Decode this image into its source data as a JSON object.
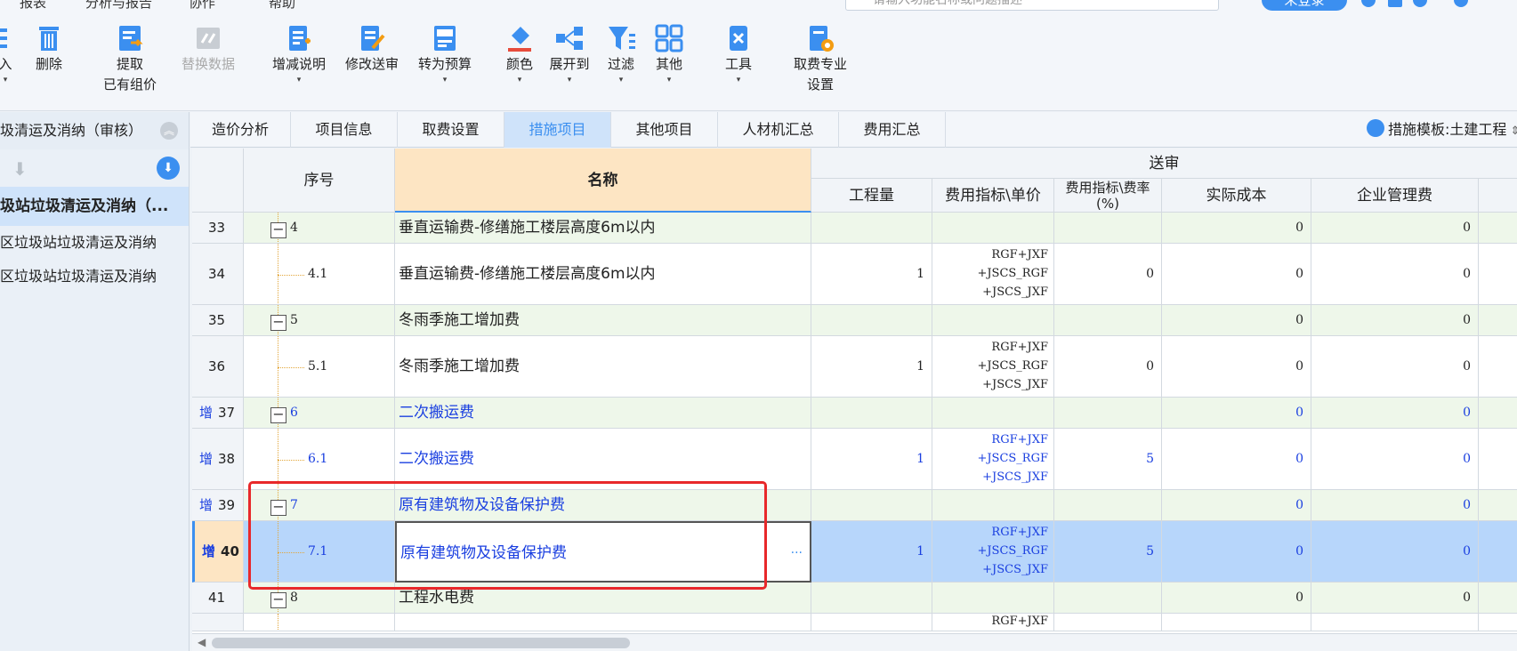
{
  "menu": [
    "报表",
    "分析与报告",
    "协作",
    "帮助"
  ],
  "search": {
    "placeholder": "请输入功能名称或问题描述"
  },
  "login_label": "未登录",
  "toolbar": {
    "import_partial": "入",
    "delete": "删除",
    "extract": "提取",
    "extract_sub": "已有组价",
    "replace": "替换数据",
    "adjust": "增减说明",
    "modify": "修改送审",
    "to_budget": "转为预算",
    "color": "颜色",
    "expand": "展开到",
    "filter": "过滤",
    "other": "其他",
    "tools": "工具",
    "fee_setting": "取费专业",
    "fee_setting_sub": "设置"
  },
  "left": {
    "header": "圾清运及消纳（审核）",
    "selected": "圾站垃圾清运及消纳（...",
    "items": [
      "区垃圾站垃圾清运及消纳",
      "区垃圾站垃圾清运及消纳"
    ]
  },
  "tabs": [
    "造价分析",
    "项目信息",
    "取费设置",
    "措施项目",
    "其他项目",
    "人材机汇总",
    "费用汇总"
  ],
  "active_tab": "措施项目",
  "measure_template": "措施模板:土建工程",
  "grid": {
    "headers": {
      "seq": "序号",
      "name": "名称",
      "group": "送审",
      "qty": "工程量",
      "unit_price": "费用指标\\单价",
      "rate": "费用指标\\费率(%)",
      "cost": "实际成本",
      "mgmt": "企业管理费"
    },
    "rows": [
      {
        "row": "33",
        "prefix": "",
        "seq": "4",
        "level": 1,
        "name": "垂直运输费-修缮施工楼层高度6m以内",
        "qty": "",
        "formula": [],
        "rate": "",
        "cost": "0",
        "mgmt": "0",
        "added": false
      },
      {
        "row": "34",
        "prefix": "",
        "seq": "4.1",
        "level": 2,
        "name": "垂直运输费-修缮施工楼层高度6m以内",
        "qty": "1",
        "formula": [
          "RGF+JXF",
          "+JSCS_RGF",
          "+JSCS_JXF"
        ],
        "rate": "0",
        "cost": "0",
        "mgmt": "0",
        "added": false
      },
      {
        "row": "35",
        "prefix": "",
        "seq": "5",
        "level": 1,
        "name": "冬雨季施工增加费",
        "qty": "",
        "formula": [],
        "rate": "",
        "cost": "0",
        "mgmt": "0",
        "added": false
      },
      {
        "row": "36",
        "prefix": "",
        "seq": "5.1",
        "level": 2,
        "name": "冬雨季施工增加费",
        "qty": "1",
        "formula": [
          "RGF+JXF",
          "+JSCS_RGF",
          "+JSCS_JXF"
        ],
        "rate": "0",
        "cost": "0",
        "mgmt": "0",
        "added": false
      },
      {
        "row": "37",
        "prefix": "增",
        "seq": "6",
        "level": 1,
        "name": "二次搬运费",
        "qty": "",
        "formula": [],
        "rate": "",
        "cost": "0",
        "mgmt": "0",
        "added": true
      },
      {
        "row": "38",
        "prefix": "增",
        "seq": "6.1",
        "level": 2,
        "name": "二次搬运费",
        "qty": "1",
        "formula": [
          "RGF+JXF",
          "+JSCS_RGF",
          "+JSCS_JXF"
        ],
        "rate": "5",
        "cost": "0",
        "mgmt": "0",
        "added": true
      },
      {
        "row": "39",
        "prefix": "增",
        "seq": "7",
        "level": 1,
        "name": "原有建筑物及设备保护费",
        "qty": "",
        "formula": [],
        "rate": "",
        "cost": "0",
        "mgmt": "0",
        "added": true
      },
      {
        "row": "40",
        "prefix": "增",
        "seq": "7.1",
        "level": 2,
        "name": "原有建筑物及设备保护费",
        "qty": "1",
        "formula": [
          "RGF+JXF",
          "+JSCS_RGF",
          "+JSCS_JXF"
        ],
        "rate": "5",
        "cost": "0",
        "mgmt": "0",
        "added": true,
        "selected": true
      },
      {
        "row": "41",
        "prefix": "",
        "seq": "8",
        "level": 1,
        "name": "工程水电费",
        "qty": "",
        "formula": [],
        "rate": "",
        "cost": "0",
        "mgmt": "0",
        "added": false
      }
    ],
    "partial_formula": "RGF+JXF"
  },
  "colors": {
    "accent": "#3b8ff0",
    "added_text": "#1a3fe0",
    "highlight": "#e8282a",
    "group_row": "#eef7ea",
    "selected_row": "#b7d6fb"
  }
}
